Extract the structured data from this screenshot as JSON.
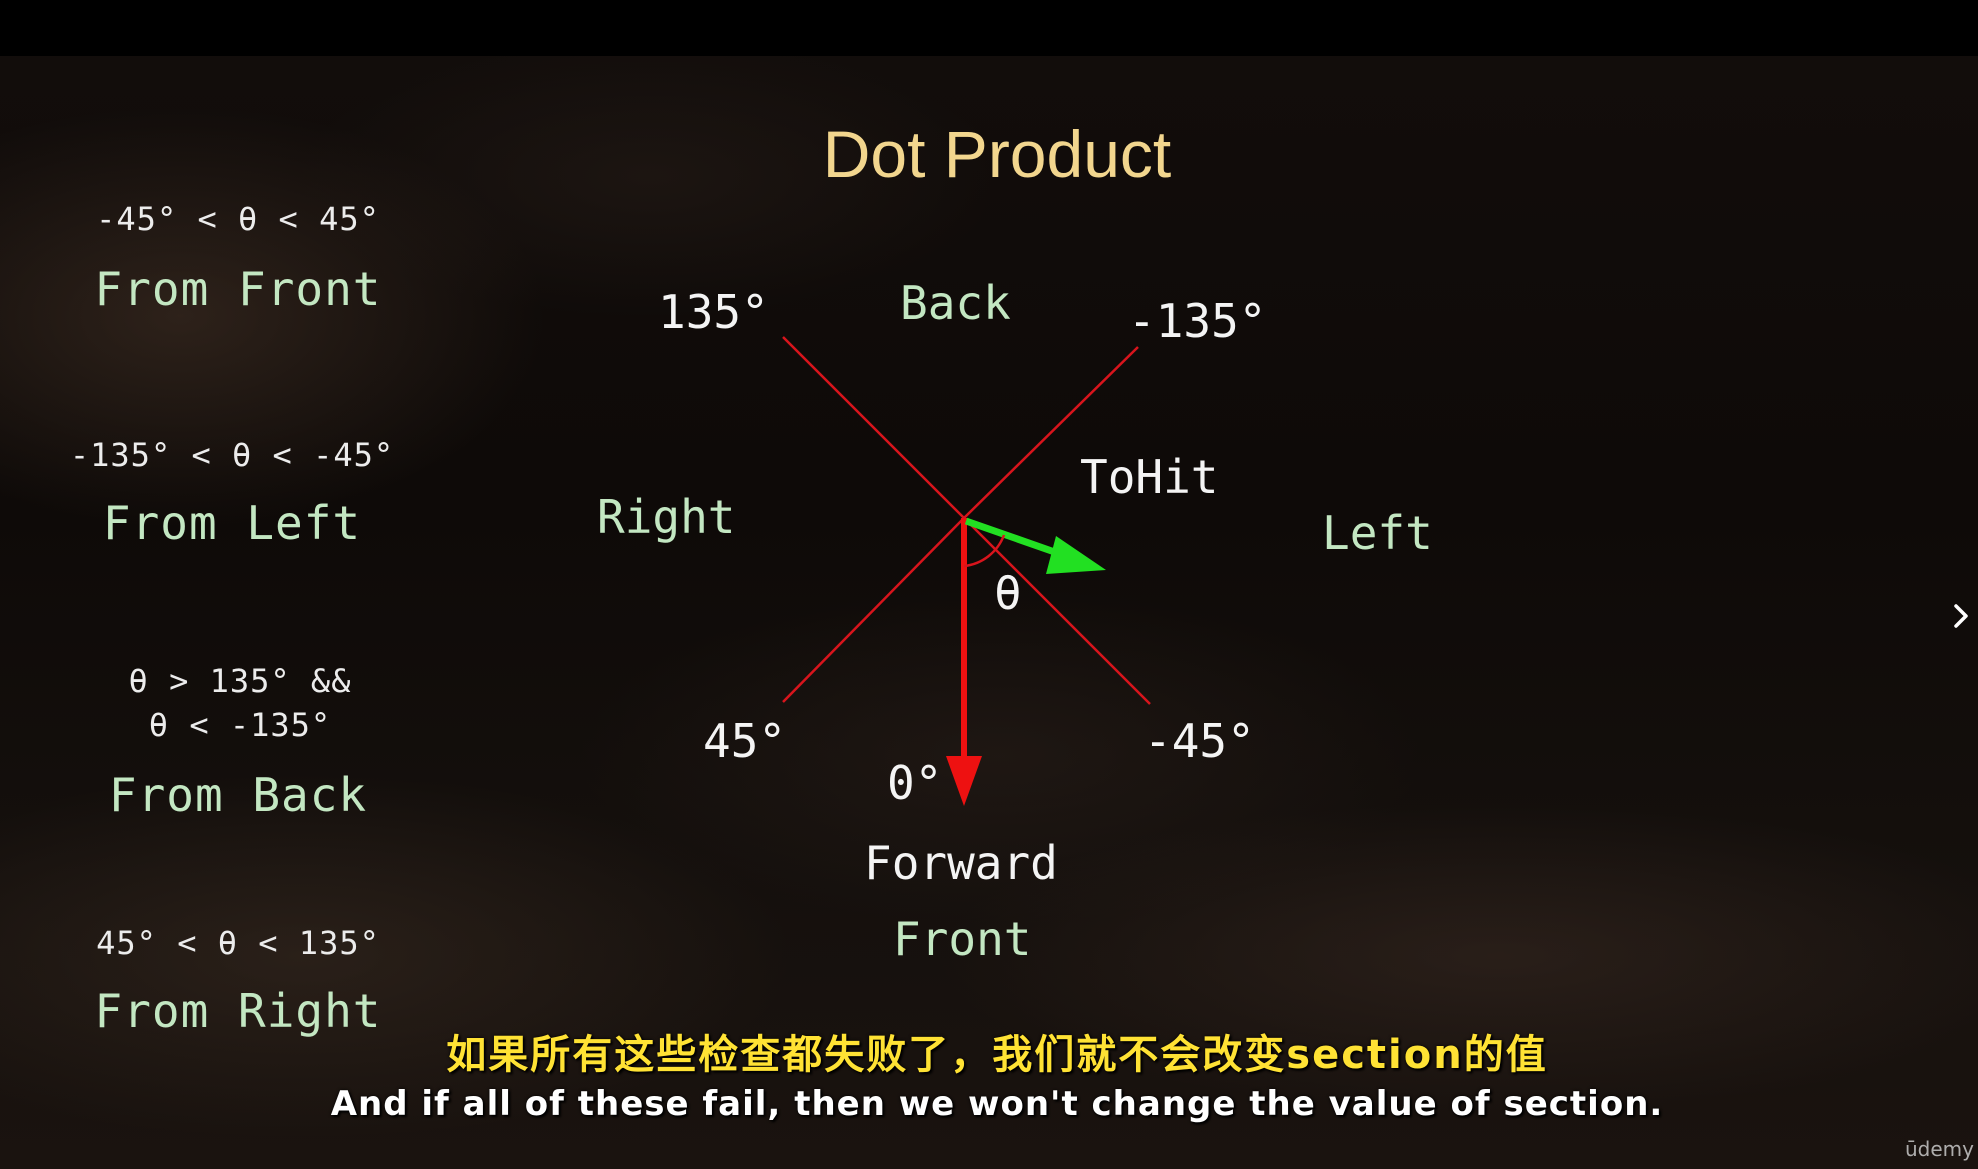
{
  "title": "Dot Product",
  "conditions": [
    {
      "condition": "-45° < θ < 45°",
      "label": "From Front"
    },
    {
      "condition": "-135° < θ < -45°",
      "label": "From Left"
    },
    {
      "condition_line1": "θ > 135° &&",
      "condition_line2": "θ < -135°",
      "label": "From Back"
    },
    {
      "condition": "45° < θ < 135°",
      "label": "From Right"
    }
  ],
  "diagram": {
    "angles": {
      "a135": "135°",
      "a_neg135": "-135°",
      "a45": "45°",
      "a_neg45": "-45°",
      "a0": "0°"
    },
    "directions": {
      "back": "Back",
      "right": "Right",
      "left": "Left",
      "front": "Front"
    },
    "tohit": "ToHit",
    "theta": "θ",
    "forward": "Forward",
    "colors": {
      "diagonal": "#d8141c",
      "forward_arrow": "#ee1111",
      "tohit_arrow": "#22e022"
    }
  },
  "subtitles": {
    "zh": "如果所有这些检查都失败了，我们就不会改变section的值",
    "en": "And if all of these fail, then we won't change the value of section."
  },
  "brand": "ūdemy",
  "icons": {
    "next": "chevron-right-icon"
  }
}
